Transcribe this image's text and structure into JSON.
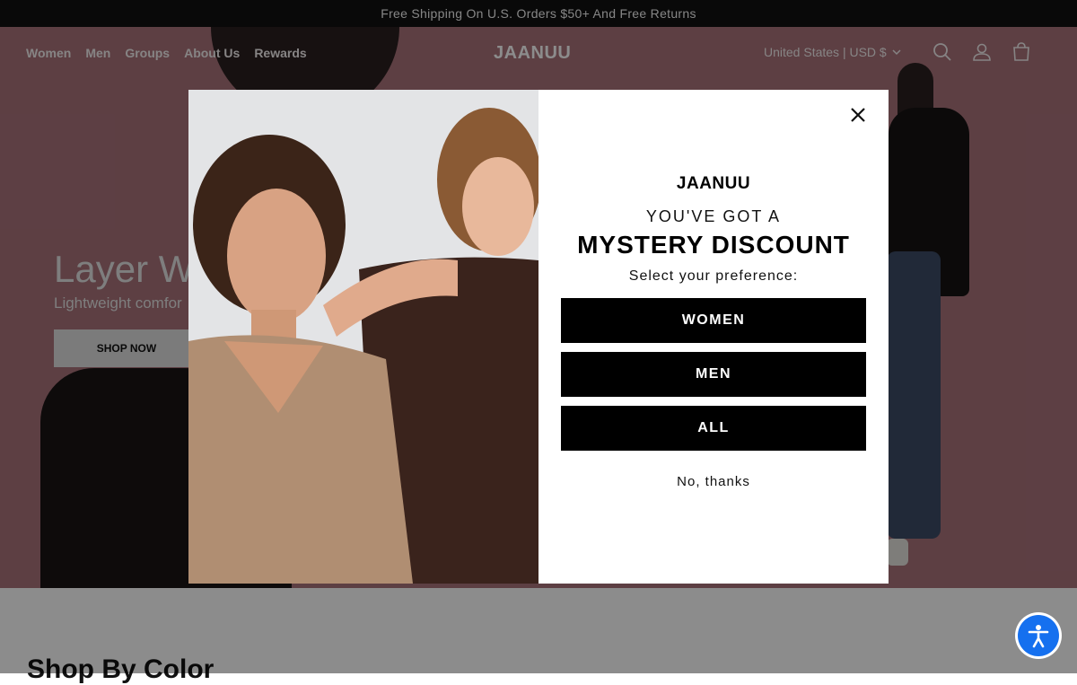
{
  "announcement": {
    "text": "Free Shipping On U.S. Orders $50+ And Free Returns"
  },
  "nav": {
    "links": [
      "Women",
      "Men",
      "Groups",
      "About Us",
      "Rewards"
    ],
    "logo": "JAANUU",
    "region": "United States | USD $"
  },
  "hero": {
    "title": "Layer W",
    "subtitle": "Lightweight comfor",
    "button": "SHOP NOW"
  },
  "section": {
    "title": "Shop By Color"
  },
  "modal": {
    "logo": "JAANUU",
    "kicker": "YOU'VE GOT A",
    "title": "MYSTERY DISCOUNT",
    "prompt": "Select your preference:",
    "buttons": {
      "women": "WOMEN",
      "men": "MEN",
      "all": "ALL"
    },
    "decline": "No, thanks"
  },
  "icons": [
    "close-icon",
    "search-icon",
    "account-icon",
    "cart-icon",
    "chevron-down-icon",
    "accessibility-icon"
  ],
  "colors": {
    "announcement_bg": "#121212",
    "hero_bg": "#a9737b",
    "cta_bg": "#000000",
    "a11y_bg": "#1570ef"
  }
}
